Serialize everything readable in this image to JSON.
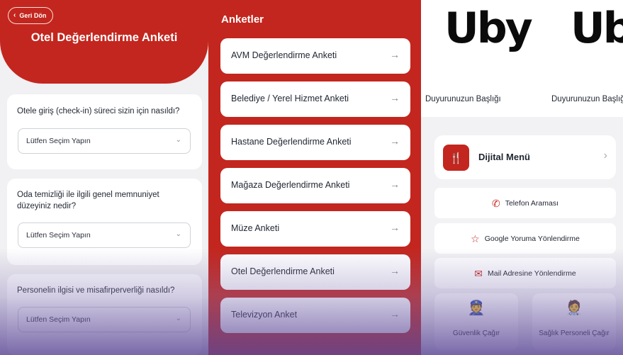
{
  "survey_form": {
    "back_label": "Geri Dön",
    "title": "Otel Değerlendirme Anketi",
    "questions": [
      {
        "text": "Otele giriş (check-in) süreci sizin için nasıldı?",
        "select_value": "Lütfen Seçim Yapın"
      },
      {
        "text": "Oda temizliği ile ilgili genel memnuniyet düzeyiniz nedir?",
        "select_value": "Lütfen Seçim Yapın"
      },
      {
        "text": "Personelin ilgisi ve misafirperverliği nasıldı?",
        "select_value": "Lütfen Seçim Yapın"
      }
    ]
  },
  "survey_list": {
    "title": "Anketler",
    "items": [
      "AVM Değerlendirme Anketi",
      "Belediye / Yerel Hizmet Anketi",
      "Hastane Değerlendirme Anketi",
      "Mağaza Değerlendirme Anketi",
      "Müze Anketi",
      "Otel Değerlendirme Anketi",
      "Televizyon Anket"
    ]
  },
  "home": {
    "logo_text": "Uby",
    "announcements": [
      "Duyurunuzun Başlığı",
      "Duyurunuzun Başlığı"
    ],
    "menu_label": "Dijital Menü",
    "actions": [
      {
        "label": "Telefon Araması",
        "icon": "phone-icon"
      },
      {
        "label": "Google Yoruma Yönlendirme",
        "icon": "star-icon"
      },
      {
        "label": "Mail Adresine Yönlendirme",
        "icon": "mail-icon"
      }
    ],
    "tiles": [
      {
        "label": "Güvenlik Çağır",
        "icon": "security-guard-icon"
      },
      {
        "label": "Sağlık Personeli Çağır",
        "icon": "medical-staff-icon"
      }
    ]
  },
  "colors": {
    "accent": "#c3261e",
    "background": "#f1f0f2"
  }
}
